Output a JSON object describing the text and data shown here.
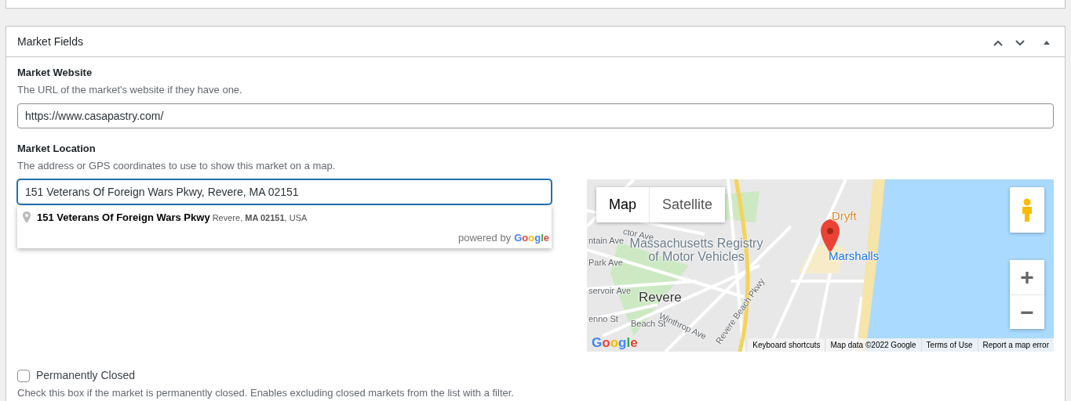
{
  "panel": {
    "title": "Market Fields",
    "controls": [
      {
        "kind": "up"
      },
      {
        "kind": "down"
      },
      {
        "kind": "toggle"
      }
    ]
  },
  "website": {
    "label": "Market Website",
    "description": "The URL of the market's website if they have one.",
    "value": "https://www.casapastry.com/"
  },
  "location": {
    "label": "Market Location",
    "description": "The address or GPS coordinates to use to show this market on a map.",
    "value": "151 Veterans Of Foreign Wars Pkwy, Revere, MA 02151",
    "focused": true,
    "suggestion": {
      "main": "151 Veterans Of Foreign Wars Pkwy",
      "secondary": "Revere, **MA 02151**, USA",
      "powered_by": "powered by",
      "brand": "Google"
    }
  },
  "map": {
    "types": [
      {
        "label": "Map",
        "selected": true
      },
      {
        "label": "Satellite",
        "selected": false
      }
    ],
    "labels": [
      {
        "text": "ctor Ave",
        "kind": "street"
      },
      {
        "text": "ntain Ave",
        "kind": "street"
      },
      {
        "text": "Massachusetts Registry of Motor Vehicles",
        "kind": "place"
      },
      {
        "text": "Park Ave",
        "kind": "street"
      },
      {
        "text": "servoir Ave",
        "kind": "street"
      },
      {
        "text": "Revere",
        "kind": "city"
      },
      {
        "text": "Winthrop Ave",
        "kind": "street"
      },
      {
        "text": "enno St",
        "kind": "street"
      },
      {
        "text": "Beach St",
        "kind": "street"
      },
      {
        "text": "Revere Beach Pkwy",
        "kind": "street"
      },
      {
        "text": "Dryft",
        "kind": "food"
      },
      {
        "text": "Marshalls",
        "kind": "shop"
      }
    ],
    "logo": "Google",
    "footer": [
      "Keyboard shortcuts",
      "Map data ©2022 Google",
      "Terms of Use",
      "Report a map error"
    ],
    "zoom": [
      "+",
      "−"
    ]
  },
  "closed": {
    "label": "Permanently Closed",
    "checked": false,
    "description": "Check this box if the market is permanently closed. Enables excluding closed markets from the list with a filter."
  }
}
